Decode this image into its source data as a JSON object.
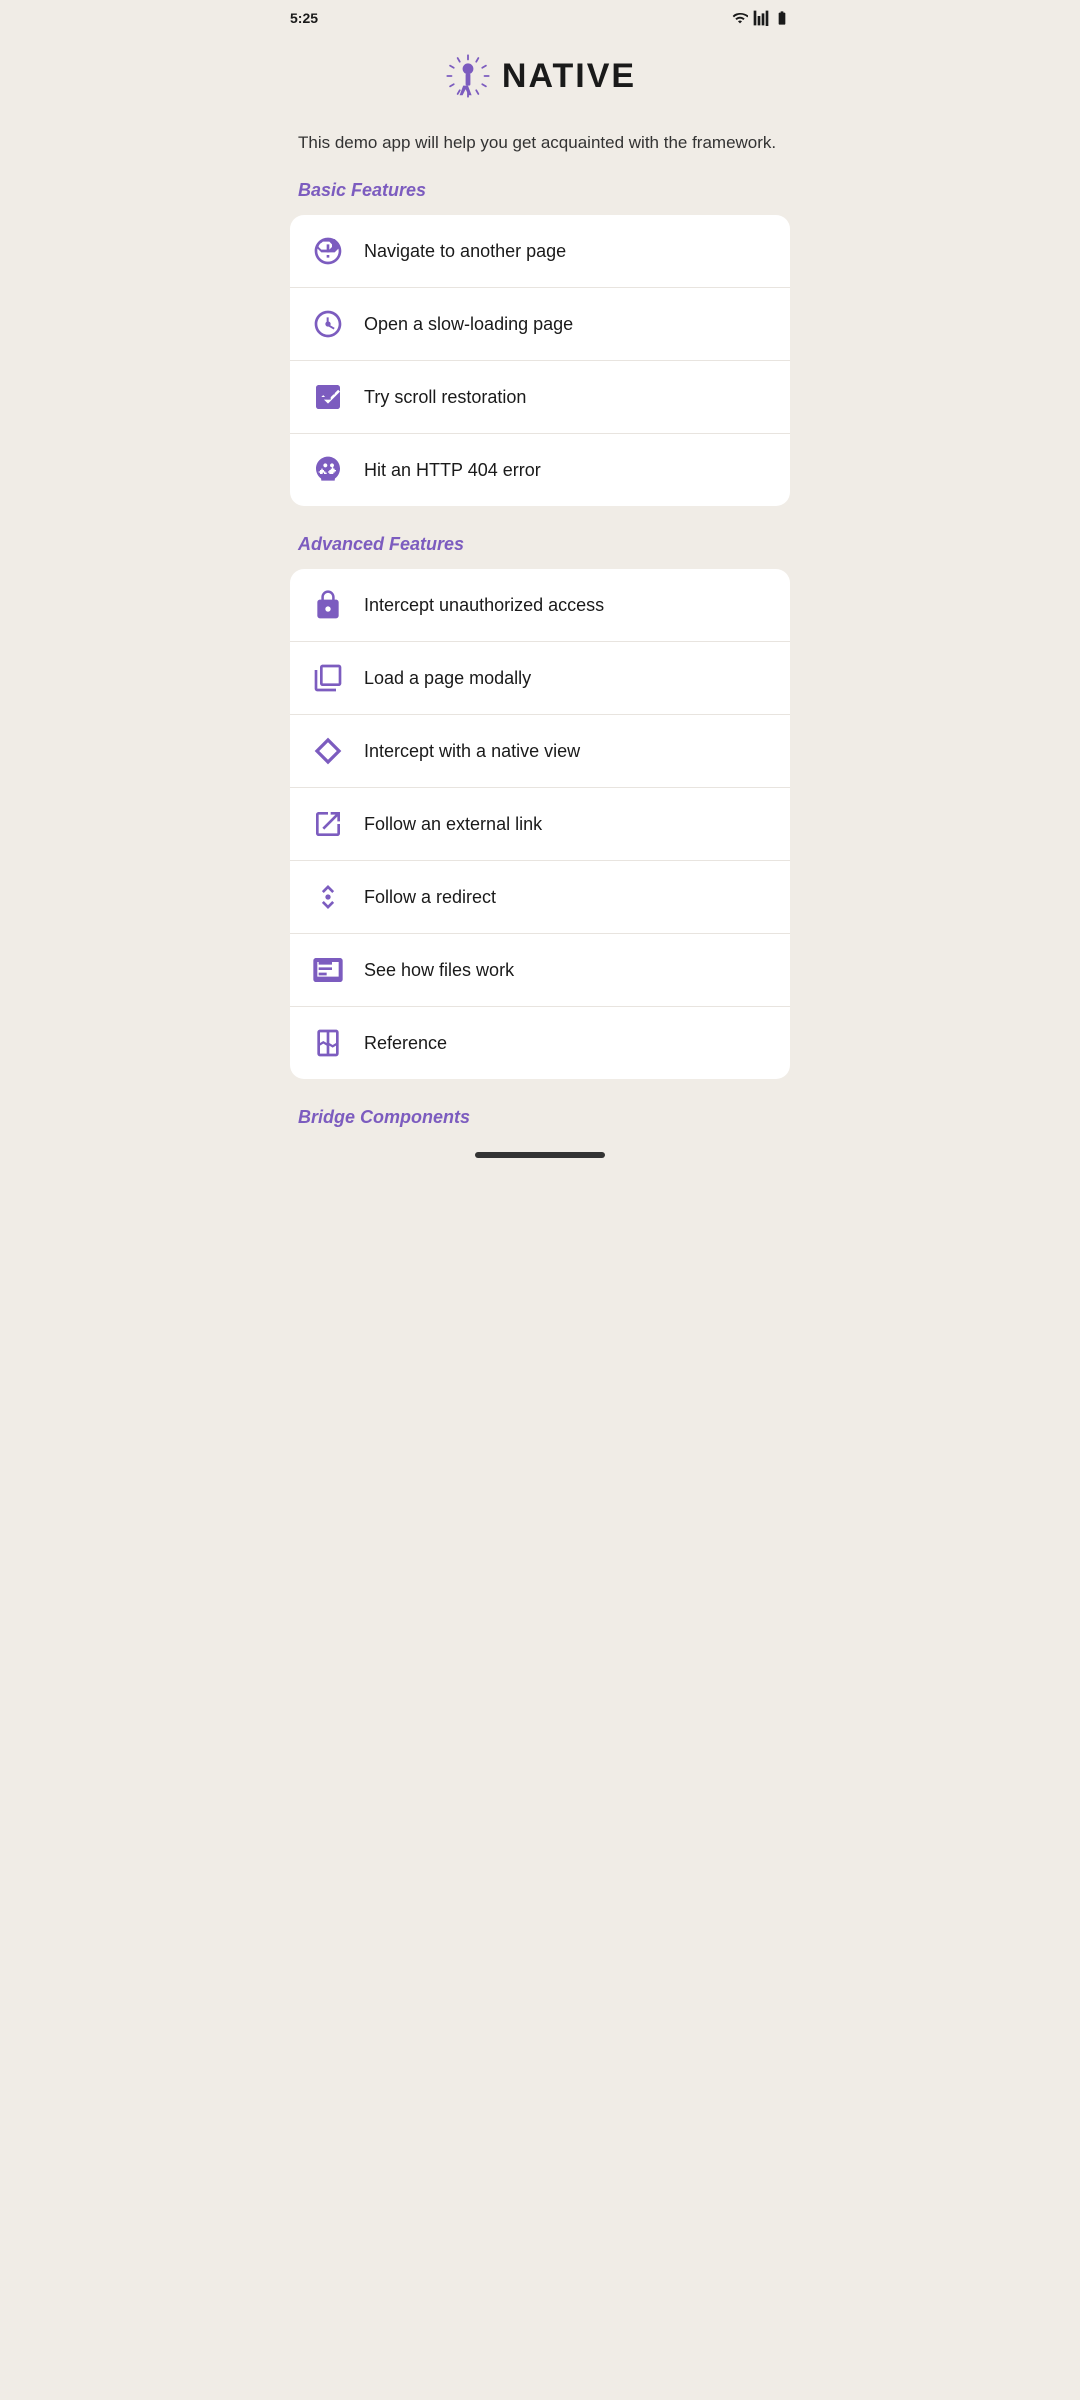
{
  "statusBar": {
    "time": "5:25"
  },
  "logo": {
    "text": "NATIVE"
  },
  "description": "This demo app will help you get acquainted with the framework.",
  "sections": [
    {
      "label": "Basic Features",
      "items": [
        {
          "id": "navigate",
          "label": "Navigate to another page",
          "icon": "signpost"
        },
        {
          "id": "slow-loading",
          "label": "Open a slow-loading page",
          "icon": "slow"
        },
        {
          "id": "scroll",
          "label": "Try scroll restoration",
          "icon": "scroll"
        },
        {
          "id": "http404",
          "label": "Hit an HTTP 404 error",
          "icon": "skull"
        }
      ]
    },
    {
      "label": "Advanced Features",
      "items": [
        {
          "id": "intercept-auth",
          "label": "Intercept unauthorized access",
          "icon": "lock"
        },
        {
          "id": "modal",
          "label": "Load a page modally",
          "icon": "modal"
        },
        {
          "id": "native-view",
          "label": "Intercept with a native view",
          "icon": "diamond"
        },
        {
          "id": "external-link",
          "label": "Follow an external link",
          "icon": "external"
        },
        {
          "id": "redirect",
          "label": "Follow a redirect",
          "icon": "redirect"
        },
        {
          "id": "files",
          "label": "See how files work",
          "icon": "files"
        },
        {
          "id": "reference",
          "label": "Reference",
          "icon": "reference"
        }
      ]
    },
    {
      "label": "Bridge Components",
      "items": []
    }
  ]
}
